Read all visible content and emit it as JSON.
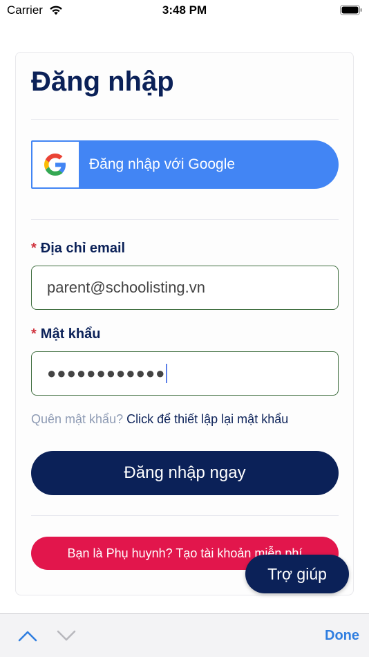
{
  "status_bar": {
    "carrier": "Carrier",
    "time": "3:48 PM"
  },
  "login": {
    "title": "Đăng nhập",
    "google_button_label": "Đăng nhập với Google",
    "required_mark": "*",
    "email_label": "Địa chỉ email",
    "email_value": "parent@schoolisting.vn",
    "password_label": "Mật khẩu",
    "password_masked": "●●●●●●●●●●●●",
    "forgot_question": "Quên mật khẩu?",
    "forgot_link": "Click để thiết lập lại mật khẩu",
    "submit_label": "Đăng nhập ngay",
    "register_label": "Bạn là Phụ huynh? Tạo tài khoản miễn phí"
  },
  "help_button_label": "Trợ giúp",
  "keyboard_toolbar": {
    "done_label": "Done"
  },
  "colors": {
    "navy": "#0b2158",
    "google_blue": "#4285f4",
    "register_red": "#e2164c",
    "input_border": "#3f6e3f",
    "done_blue": "#2f7ee0"
  },
  "icons": [
    "wifi-icon",
    "battery-icon",
    "google-icon",
    "chevron-up-icon",
    "chevron-down-icon"
  ]
}
